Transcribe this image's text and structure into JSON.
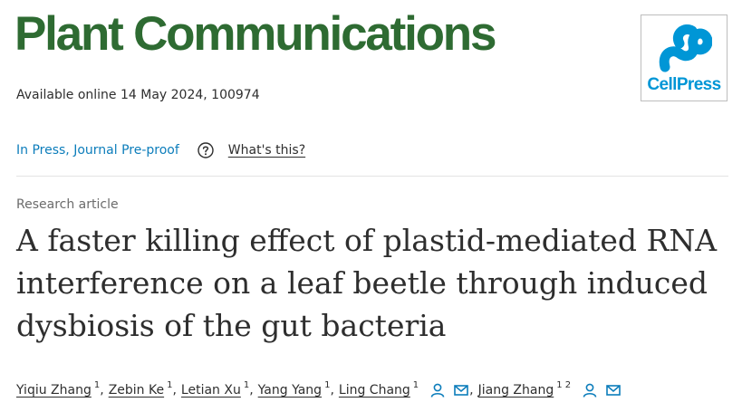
{
  "journal": {
    "title": "Plant Communications",
    "title_color": "#2e6b32",
    "availability": "Available online 14 May 2024, 100974"
  },
  "publisher_logo": {
    "wordmark": "CellPress",
    "color": "#0096d6",
    "icon": "cellpress-logo-icon"
  },
  "status": {
    "label": "In Press, Journal Pre-proof",
    "help_icon": "question-circle-icon",
    "help_link": "What's this?",
    "link_color": "#0c7dbb"
  },
  "article": {
    "type": "Research article",
    "title": "A faster killing effect of plastid-mediated RNA interference on a leaf beetle through induced dysbiosis of the gut bacteria"
  },
  "authors": [
    {
      "name": "Yiqiu Zhang",
      "affiliations": "1",
      "separator": ","
    },
    {
      "name": "Zebin Ke",
      "affiliations": "1",
      "separator": ","
    },
    {
      "name": "Letian Xu",
      "affiliations": "1",
      "separator": ","
    },
    {
      "name": "Yang Yang",
      "affiliations": "1",
      "separator": ","
    },
    {
      "name": "Ling Chang",
      "affiliations": "1",
      "separator": ",",
      "icons": [
        "person-icon",
        "envelope-icon"
      ]
    },
    {
      "name": "Jiang Zhang",
      "affiliations": "1 2",
      "icons": [
        "person-icon",
        "envelope-icon"
      ]
    }
  ]
}
